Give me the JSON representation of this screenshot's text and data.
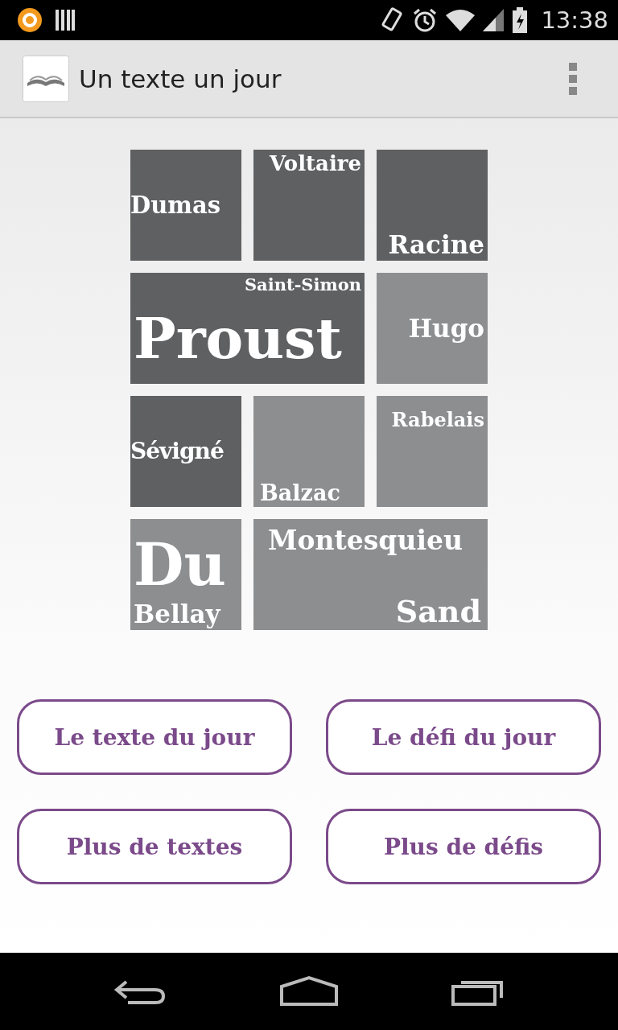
{
  "status_bar": {
    "time": "13:38"
  },
  "action_bar": {
    "title": "Un texte un jour"
  },
  "tiles": [
    {
      "color": "#5f6062",
      "words": [
        {
          "text": "Dumas",
          "kind": "medium"
        }
      ]
    },
    {
      "color": "#5f6062",
      "words": [
        {
          "text": "Voltaire",
          "kind": "small"
        }
      ]
    },
    {
      "color": "#5f6062",
      "words": [
        {
          "text": "Racine",
          "kind": "medium"
        }
      ]
    },
    {
      "color": "#5f6062",
      "words": [
        {
          "text": "Saint-Simon",
          "kind": "tiny"
        },
        {
          "text": "Proust",
          "kind": "huge"
        }
      ]
    },
    {
      "color": "#8d8e90",
      "words": [
        {
          "text": "Hugo",
          "kind": "medium"
        }
      ]
    },
    {
      "color": "#5f6062",
      "words": [
        {
          "text": "Sévigné",
          "kind": "medium"
        }
      ]
    },
    {
      "color": "#8d8e90",
      "words": [
        {
          "text": "Balzac",
          "kind": "small"
        }
      ]
    },
    {
      "color": "#8d8e90",
      "words": [
        {
          "text": "Rabelais",
          "kind": "small"
        }
      ]
    },
    {
      "color": "#8d8e90",
      "words": [
        {
          "text": "Du",
          "kind": "large"
        },
        {
          "text": "Bellay",
          "kind": "medium"
        }
      ]
    },
    {
      "color": "#8d8e90",
      "words": [
        {
          "text": "Montesquieu",
          "kind": "medium"
        },
        {
          "text": "Sand",
          "kind": "medium"
        }
      ]
    }
  ],
  "buttons": [
    {
      "label": "Le texte du jour"
    },
    {
      "label": "Le défi du jour"
    },
    {
      "label": "Plus de textes"
    },
    {
      "label": "Plus de défis"
    }
  ]
}
